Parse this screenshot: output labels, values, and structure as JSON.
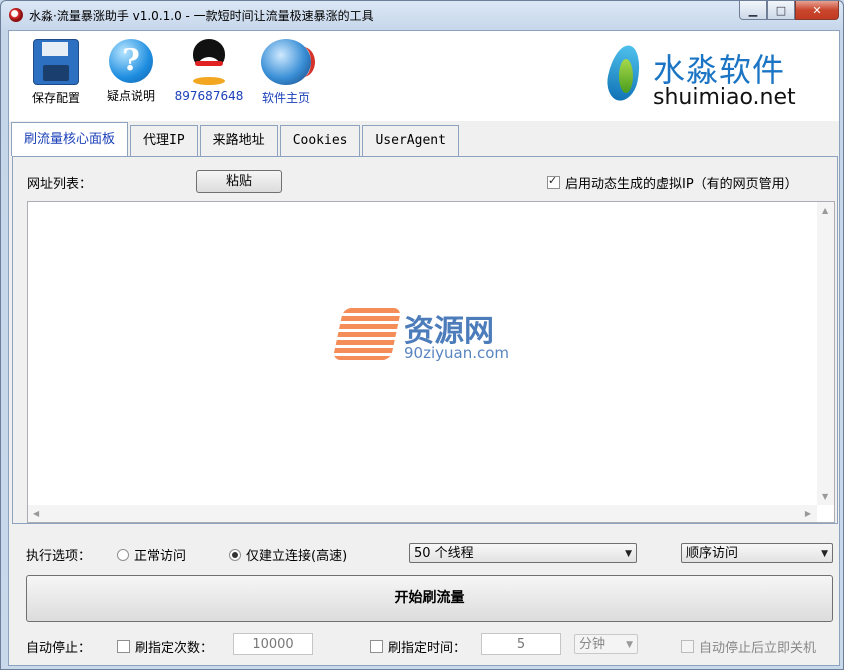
{
  "window": {
    "title": "水淼·流量暴涨助手 v1.0.1.0 - 一款短时间让流量极速暴涨的工具",
    "min_icon": "minimize-icon",
    "max_icon": "maximize-icon",
    "close_icon": "close-icon"
  },
  "toolbar": {
    "save_label": "保存配置",
    "help_label": "疑点说明",
    "qq_label": "897687648",
    "home_label": "软件主页"
  },
  "brand": {
    "name_cn": "水淼软件",
    "name_en": "shuimiao.net"
  },
  "tabs": [
    "刷流量核心面板",
    "代理IP",
    "来路地址",
    "Cookies",
    "UserAgent"
  ],
  "panel": {
    "url_list_label": "网址列表：",
    "paste_label": "粘贴",
    "virtual_ip_label": "启用动态生成的虚拟IP（有的网页管用）",
    "virtual_ip_checked": true
  },
  "watermark": {
    "cn": "资源网",
    "en": "90ziyuan.com"
  },
  "options": {
    "exec_label": "执行选项：",
    "radio_normal": "正常访问",
    "radio_fast": "仅建立连接(高速)",
    "selected_radio": "fast",
    "threads_value": "50 个线程",
    "order_value": "顺序访问"
  },
  "start_label": "开始刷流量",
  "autostop": {
    "label": "自动停止：",
    "count_label": "刷指定次数：",
    "count_value": "10000",
    "time_label": "刷指定时间：",
    "time_value": "5",
    "unit_value": "分钟",
    "shutdown_label": "自动停止后立即关机"
  },
  "colors": {
    "accent_tab": "#1a3fb8",
    "brand_blue": "#1b75c4",
    "close_red": "#c9462d"
  }
}
